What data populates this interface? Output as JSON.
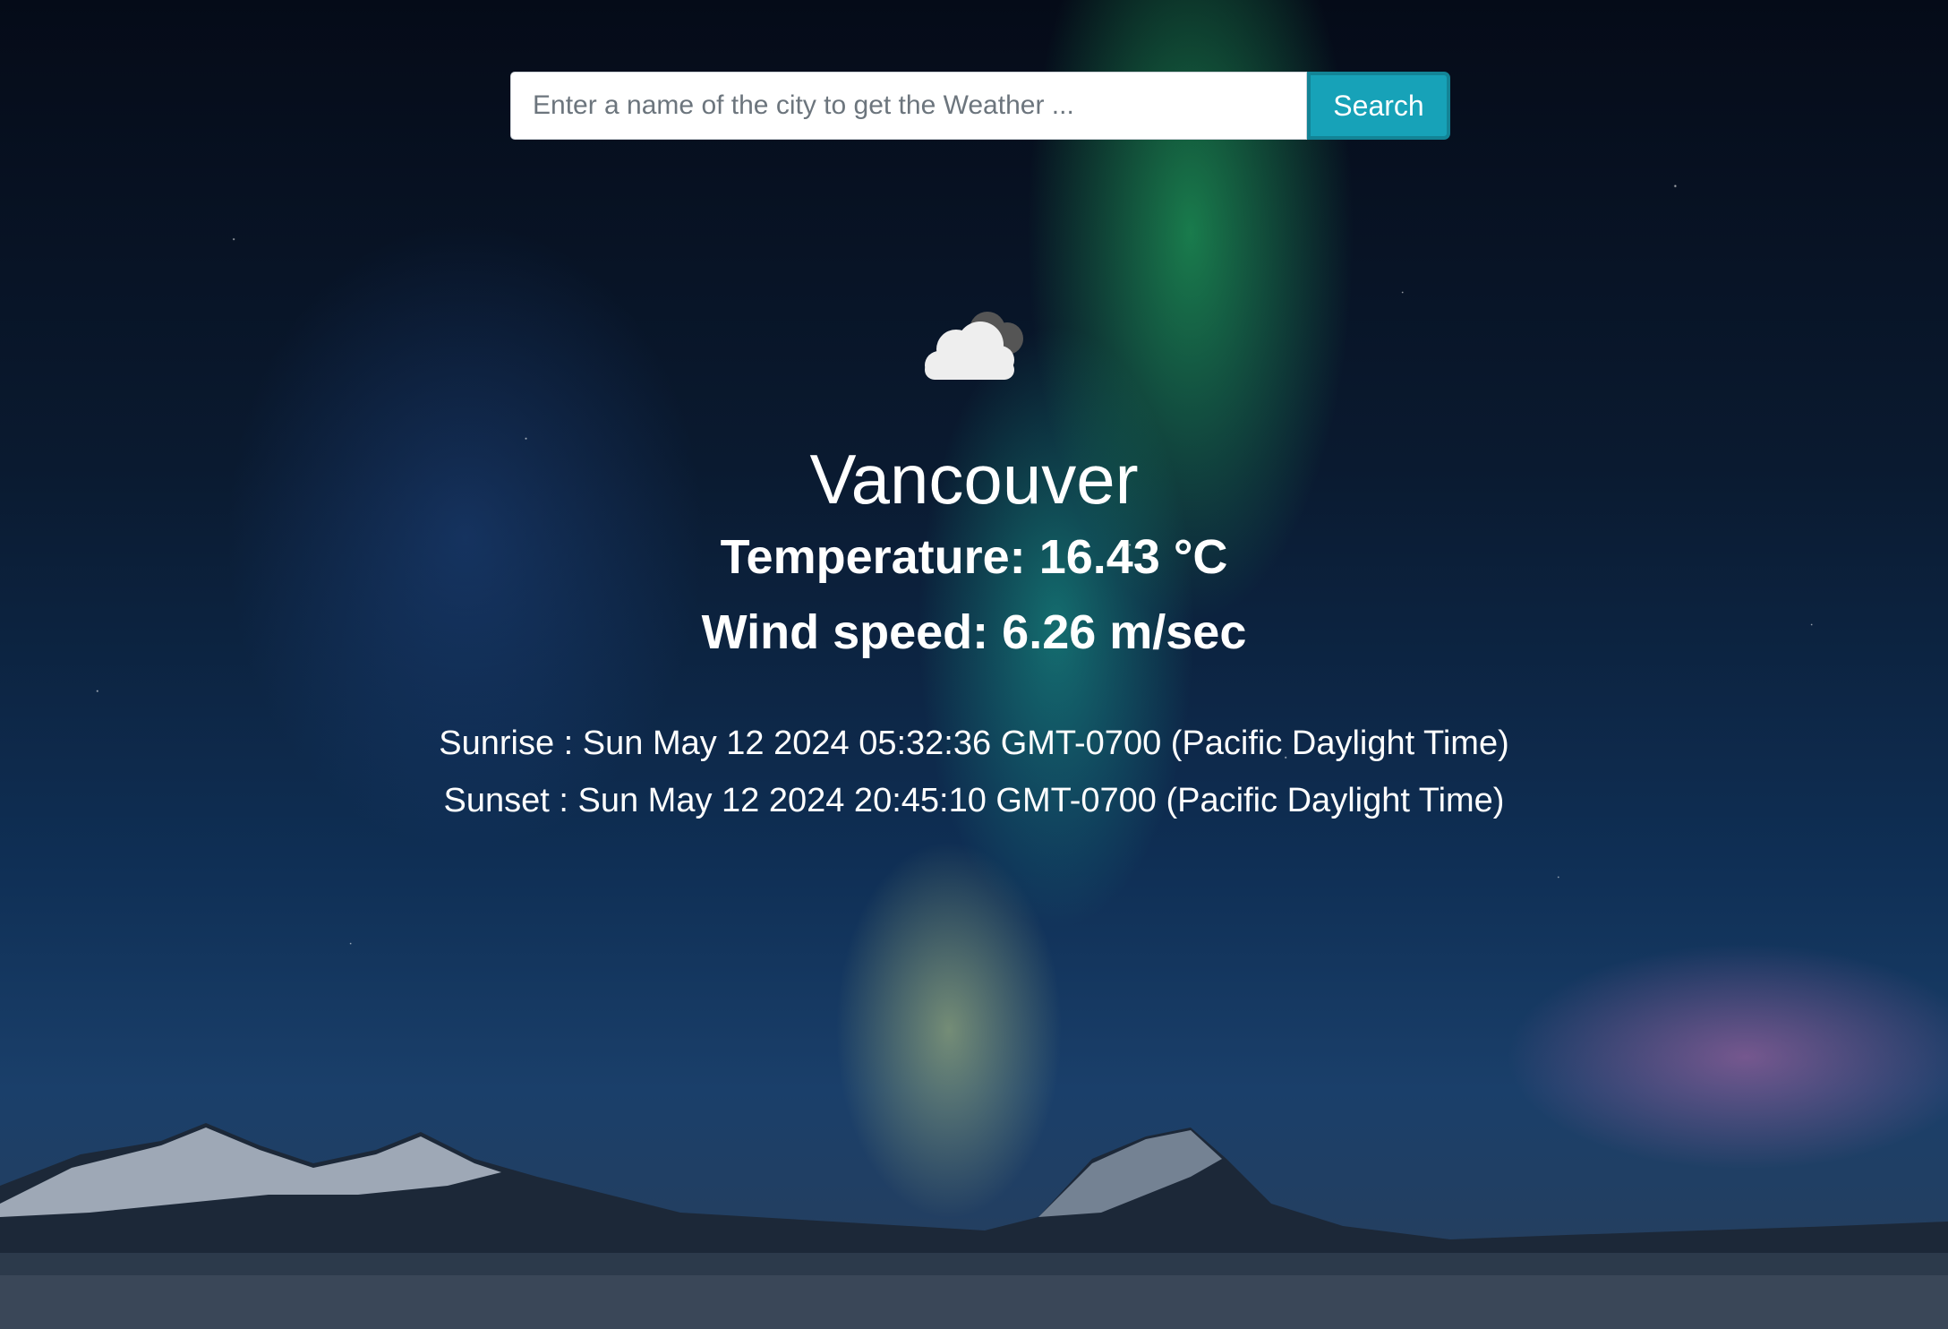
{
  "search": {
    "placeholder": "Enter a name of the city to get the Weather ...",
    "value": "",
    "button_label": "Search"
  },
  "weather": {
    "icon": "cloudy-night-icon",
    "city": "Vancouver",
    "temperature_label": "Temperature:",
    "temperature_value": "16.43 °C",
    "wind_label": "Wind speed:",
    "wind_value": "6.26 m/sec",
    "sunrise_label": "Sunrise :",
    "sunrise_value": "Sun May 12 2024 05:32:36 GMT-0700 (Pacific Daylight Time)",
    "sunset_label": "Sunset :",
    "sunset_value": "Sun May 12 2024 20:45:10 GMT-0700 (Pacific Daylight Time)"
  },
  "colors": {
    "search_button": "#17a2b8",
    "search_button_border": "#138496",
    "text": "#ffffff"
  }
}
